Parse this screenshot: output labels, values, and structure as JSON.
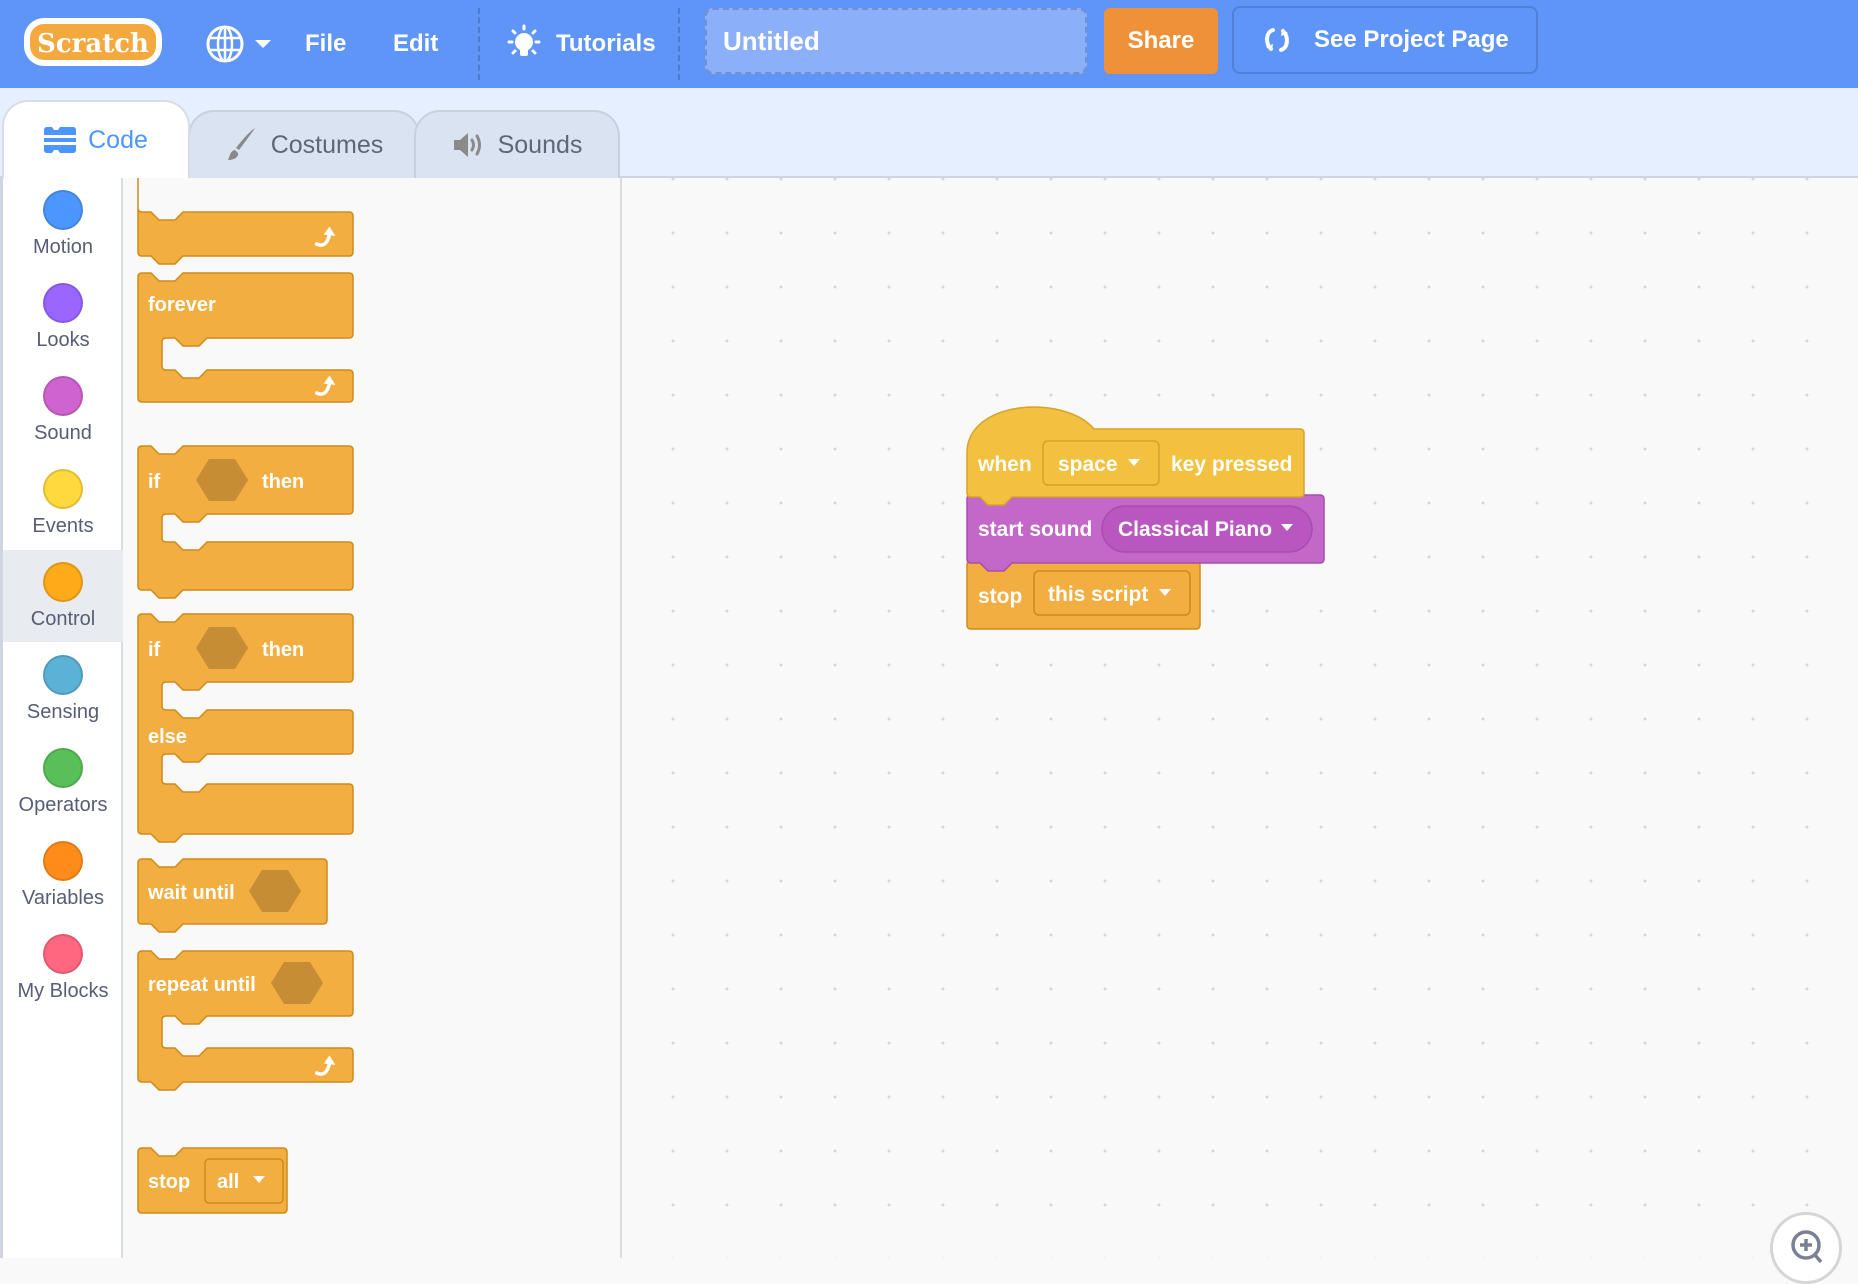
{
  "menubar": {
    "logo": "Scratch",
    "language_icon": "globe-icon",
    "file": "File",
    "edit": "Edit",
    "tutorials": "Tutorials",
    "project_title": "Untitled",
    "share": "Share",
    "see_project_page": "See Project Page"
  },
  "tabs": [
    {
      "label": "Code",
      "icon": "code-icon",
      "active": true
    },
    {
      "label": "Costumes",
      "icon": "brush-icon",
      "active": false
    },
    {
      "label": "Sounds",
      "icon": "speaker-icon",
      "active": false
    }
  ],
  "categories": [
    {
      "label": "Motion",
      "color": "#4c97ff"
    },
    {
      "label": "Looks",
      "color": "#9966ff"
    },
    {
      "label": "Sound",
      "color": "#cf63cf"
    },
    {
      "label": "Events",
      "color": "#ffd500"
    },
    {
      "label": "Control",
      "color": "#ffab19",
      "selected": true
    },
    {
      "label": "Sensing",
      "color": "#5cb1d6"
    },
    {
      "label": "Operators",
      "color": "#59c059"
    },
    {
      "label": "Variables",
      "color": "#ff8c1a"
    },
    {
      "label": "My Blocks",
      "color": "#ff6680"
    }
  ],
  "palette": {
    "forever": "forever",
    "if": "if",
    "then": "then",
    "else": "else",
    "wait_until": "wait until",
    "repeat_until": "repeat until",
    "stop": "stop",
    "stop_option": "all"
  },
  "script": {
    "when": "when",
    "key": "space",
    "key_pressed": "key pressed",
    "start_sound": "start sound",
    "sound": "Classical Piano",
    "stop": "stop",
    "stop_option": "this script"
  },
  "colors": {
    "menubar": "#5f95f7",
    "control": "#ffab19",
    "events": "#ffbf00",
    "sound": "#cf63cf",
    "share": "#ef9139"
  }
}
